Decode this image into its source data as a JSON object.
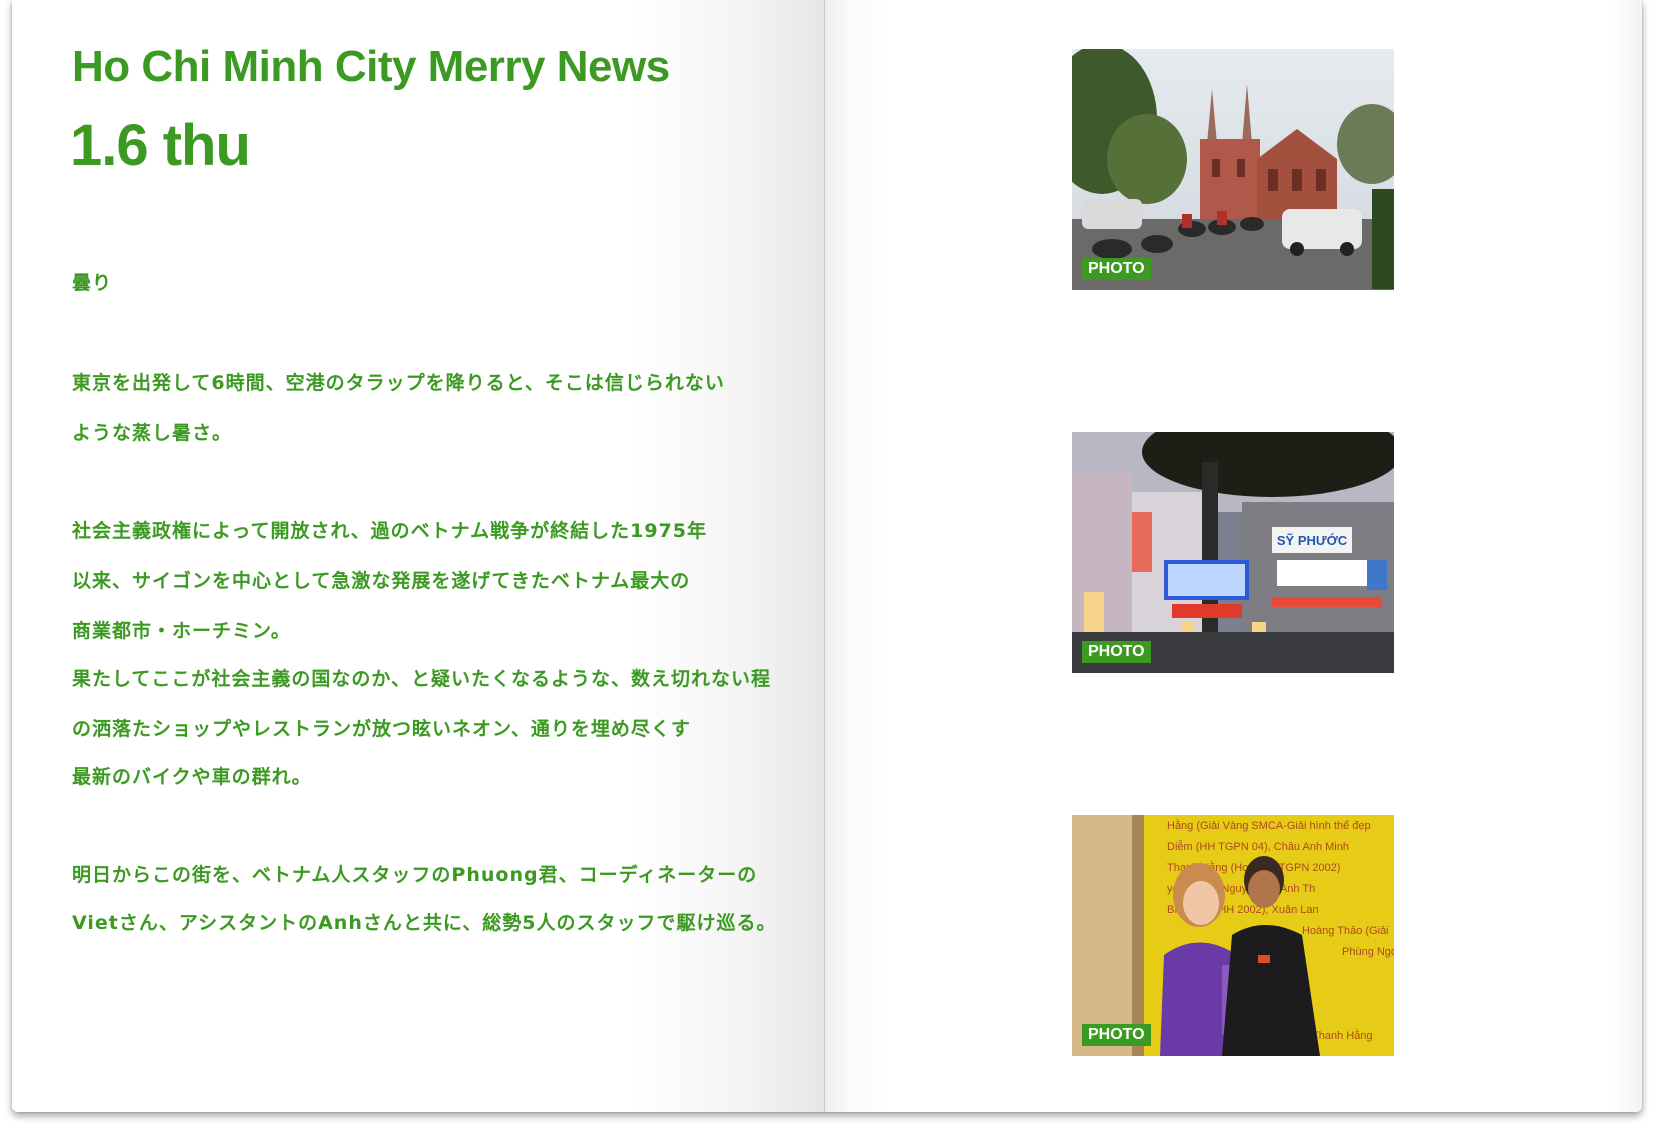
{
  "article": {
    "title": "Ho Chi Minh City Merry News",
    "date": "1.6 thu",
    "weather": "曇り",
    "lines": [
      "東京を出発して6時間、空港のタラップを降りると、そこは信じられない",
      "ような蒸し暑さ。",
      "社会主義政権によって開放され、過のベトナム戦争が終結した1975年",
      "以来、サイゴンを中心として急激な発展を遂げてきたベトナム最大の",
      "商業都市・ホーチミン。",
      "果たしてここが社会主義の国なのか、と疑いたくなるような、数え切れない程",
      "の洒落たショップやレストランが放つ眩いネオン、通りを埋め尽くす",
      "最新のバイクや車の群れ。",
      "明日からこの街を、ベトナム人スタッフのPhuong君、コーディネーターの",
      "Vietさん、アシスタントのAnhさんと共に、総勢5人のスタッフで駆け巡る。"
    ]
  },
  "photos": [
    {
      "badge": "PHOTO"
    },
    {
      "badge": "PHOTO"
    },
    {
      "badge": "PHOTO"
    }
  ],
  "poster_text": [
    "Hằng (Giải Vàng SMCA-Giải hình thể đẹp",
    "Diễm (HH TGPN 04), Châu Anh Minh",
    "Thanh Hằng (Hoa hậu TGPN 2002)",
    "yêu thích), Nguyễn Thị Anh Th",
    "Bích Duy (HH 2002), Xuân Lan",
    "Hoàng Thảo (Giải",
    "Phùng Ngọc",
    "Thanh Hằng"
  ],
  "shop_signs": [
    "SỸ PHƯỚC"
  ],
  "colors": {
    "accent": "#3c9a23"
  }
}
